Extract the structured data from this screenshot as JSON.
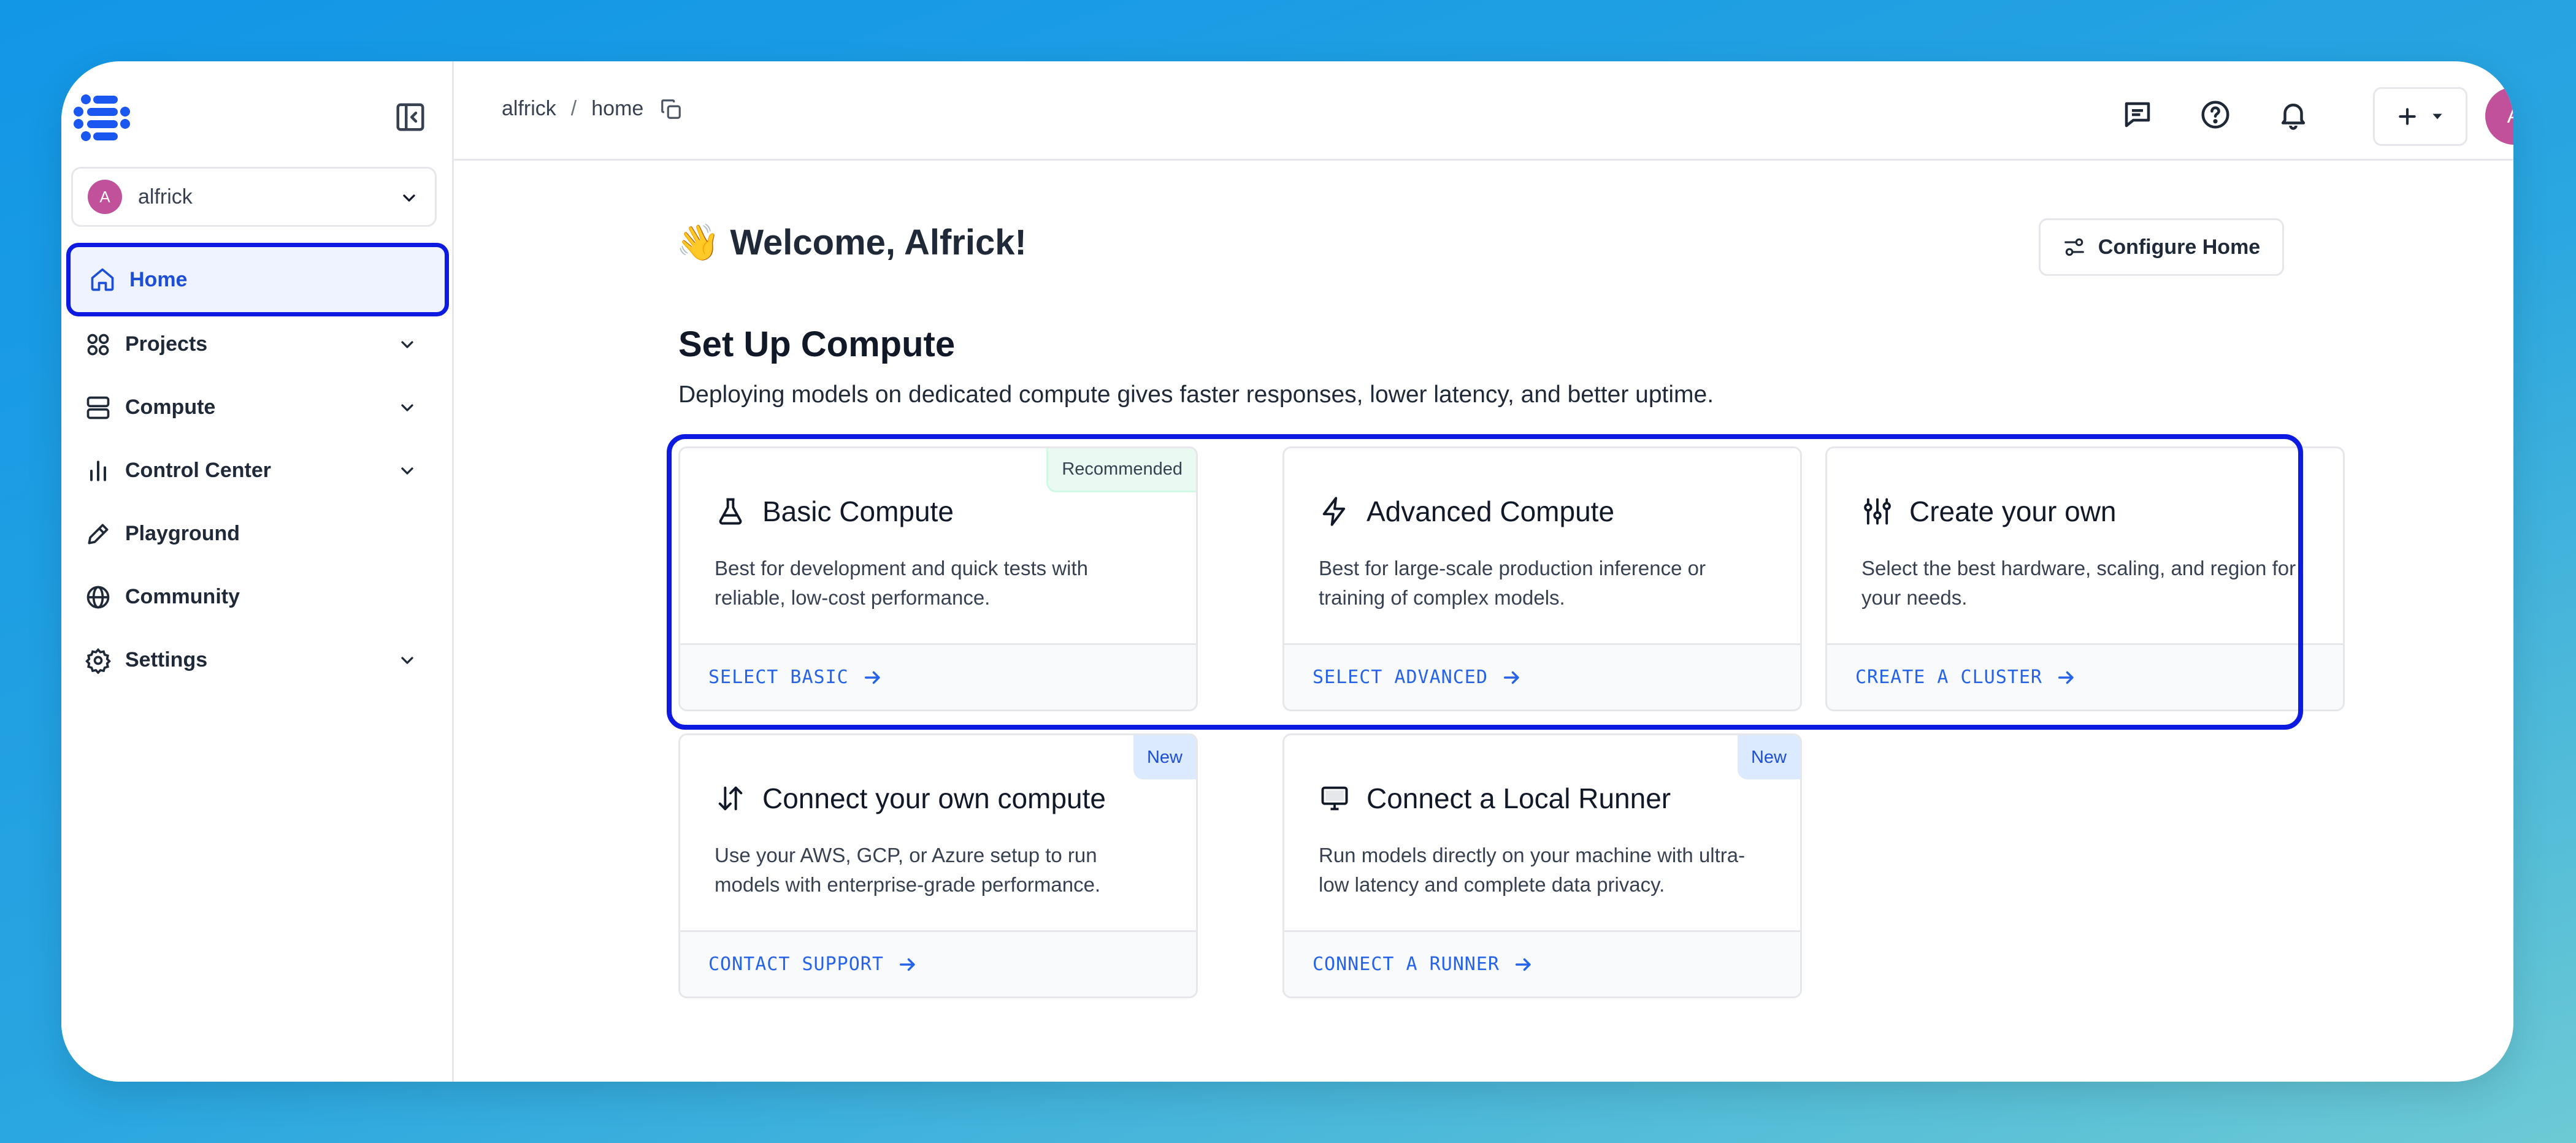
{
  "org": {
    "avatar": "A",
    "name": "alfrick"
  },
  "nav": {
    "home": "Home",
    "projects": "Projects",
    "compute": "Compute",
    "control_center": "Control Center",
    "playground": "Playground",
    "community": "Community",
    "settings": "Settings"
  },
  "breadcrumb": {
    "org": "alfrick",
    "sep": "/",
    "page": "home"
  },
  "user": {
    "avatar": "A"
  },
  "main": {
    "welcome": "👋 Welcome, Alfrick!",
    "configure_label": "Configure Home",
    "section_title": "Set Up Compute",
    "section_desc": "Deploying models on dedicated compute gives faster responses, lower latency, and better uptime."
  },
  "cards": [
    {
      "title": "Basic Compute",
      "desc": "Best for development and quick tests with reliable, low-cost performance.",
      "action": "SELECT BASIC",
      "badge": "Recommended",
      "icon": "flask-icon"
    },
    {
      "title": "Advanced Compute",
      "desc": "Best for large-scale production inference or training of complex models.",
      "action": "SELECT ADVANCED",
      "badge": "",
      "icon": "lightning-icon"
    },
    {
      "title": "Create your own",
      "desc": "Select the best hardware, scaling, and region for your needs.",
      "action": "CREATE A CLUSTER",
      "badge": "",
      "icon": "sliders-icon"
    },
    {
      "title": "Connect your own compute",
      "desc": "Use your AWS, GCP, or Azure setup to run models with enterprise-grade performance.",
      "action": "CONTACT SUPPORT",
      "badge": "New",
      "icon": "arrows-updown-icon"
    },
    {
      "title": "Connect a Local Runner",
      "desc": "Run models directly on your machine with ultra-low latency and complete data privacy.",
      "action": "CONNECT A RUNNER",
      "badge": "New",
      "icon": "monitor-icon"
    }
  ],
  "colors": {
    "accent": "#2563eb",
    "highlight": "#0d1be0",
    "avatar": "#c0519a",
    "active_bg": "#eef3ff"
  }
}
